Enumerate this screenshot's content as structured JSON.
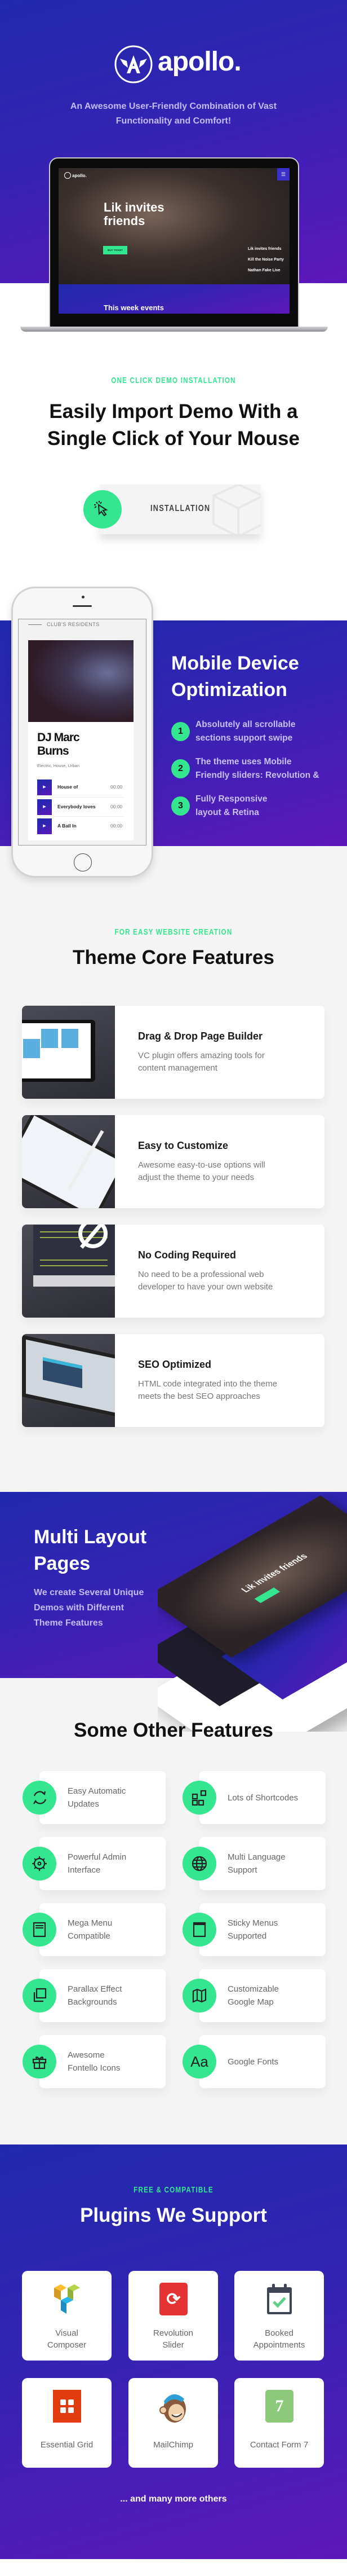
{
  "colors": {
    "accent_green": "#34e68f",
    "gradient_start": "#2029ad",
    "gradient_end": "#5d17ba",
    "section_gray": "#f4f4f4"
  },
  "hero": {
    "brand": "apollo.",
    "subtitle_line1": "An Awesome User-Friendly Combination of Vast",
    "subtitle_line2": "Functionality and Comfort!",
    "mockup": {
      "logo": "apollo.",
      "slide_title_line1": "Lik invites",
      "slide_title_line2": "friends",
      "button": "BUY TICKET",
      "events": [
        "Lik invites friends",
        "Kill the Noise Party",
        "Nathan Fake Live"
      ],
      "section_title": "This week events"
    }
  },
  "install": {
    "eyebrow": "ONE CLICK DEMO INSTALLATION",
    "title_line1": "Easily Import Demo With a",
    "title_line2": "Single Click of Your Mouse",
    "button": "INSTALLATION",
    "icon": "cursor-click-icon"
  },
  "mobile": {
    "phone": {
      "section_label": "CLUB'S RESIDENTS",
      "dj_line1": "DJ Marc",
      "dj_line2": "Burns",
      "genres": "Electric, House, Urban",
      "tracks": [
        {
          "title": "House of",
          "time": "00:00"
        },
        {
          "title": "Everybody loves",
          "time": "00:00"
        },
        {
          "title": "A Ball In",
          "time": "00:00"
        }
      ]
    },
    "title_line1": "Mobile Device",
    "title_line2": "Optimization",
    "items": [
      {
        "num": "1",
        "line1": "Absolutely all scrollable",
        "line2": "sections support swipe"
      },
      {
        "num": "2",
        "line1": "The theme uses Mobile",
        "line2": "Friendly sliders: Revolution &"
      },
      {
        "num": "3",
        "line1": "Fully Responsive",
        "line2": "layout & Retina"
      }
    ]
  },
  "core": {
    "eyebrow": "FOR EASY WEBSITE CREATION",
    "title": "Theme Core Features",
    "cards": [
      {
        "title": "Drag & Drop Page Builder",
        "line1": "VC plugin offers amazing tools for",
        "line2": "content management",
        "image": "laptop-page-builder"
      },
      {
        "title": "Easy to Customize",
        "line1": "Awesome easy-to-use options will",
        "line2": "adjust the theme to your needs",
        "image": "tablet-with-pen"
      },
      {
        "title": "No Coding Required",
        "line1": "No need to be a professional web",
        "line2": "developer to have your own website",
        "image": "monitor-no-code"
      },
      {
        "title": "SEO Optimized",
        "line1": "HTML code integrated into the theme",
        "line2": "meets the best SEO approaches",
        "image": "tablet-seo"
      }
    ]
  },
  "multi": {
    "title_line1": "Multi Layout",
    "title_line2": "Pages",
    "desc_line1": "We create Several Unique",
    "desc_line2": "Demos with Different",
    "desc_line3": "Theme Features",
    "mockup_title": "Lik invites friends"
  },
  "other": {
    "title": "Some Other Features",
    "items": [
      {
        "line1": "Easy Automatic",
        "line2": "Updates",
        "icon": "refresh-icon"
      },
      {
        "line1": "Lots of Shortcodes",
        "line2": "",
        "icon": "shortcodes-grid-icon"
      },
      {
        "line1": "Powerful Admin",
        "line2": "Interface",
        "icon": "gear-icon"
      },
      {
        "line1": "Multi Language",
        "line2": "Support",
        "icon": "globe-icon"
      },
      {
        "line1": "Mega Menu",
        "line2": "Compatible",
        "icon": "mega-menu-icon"
      },
      {
        "line1": "Sticky Menus",
        "line2": "Supported",
        "icon": "sticky-menu-icon"
      },
      {
        "line1": "Parallax Effect",
        "line2": "Backgrounds",
        "icon": "layers-icon"
      },
      {
        "line1": "Customizable",
        "line2": "Google Map",
        "icon": "map-icon"
      },
      {
        "line1": "Awesome",
        "line2": "Fontello Icons",
        "icon": "gift-icon"
      },
      {
        "line1": "Google Fonts",
        "line2": "",
        "icon": "font-aa-icon",
        "glyph": "Aa"
      }
    ]
  },
  "plugins": {
    "eyebrow": "FREE & COMPATIBLE",
    "title": "Plugins We Support",
    "items": [
      {
        "line1": "Visual",
        "line2": "Composer",
        "icon": "visual-composer-icon"
      },
      {
        "line1": "Revolution",
        "line2": "Slider",
        "icon": "revolution-slider-icon"
      },
      {
        "line1": "Booked",
        "line2": "Appointments",
        "icon": "calendar-check-icon"
      },
      {
        "line1": "Essential Grid",
        "line2": "",
        "icon": "essential-grid-icon"
      },
      {
        "line1": "MailChimp",
        "line2": "",
        "icon": "mailchimp-icon"
      },
      {
        "line1": "Contact Form 7",
        "line2": "",
        "icon": "contact-form-7-icon",
        "glyph": "7"
      }
    ],
    "footer": "... and many more others"
  }
}
